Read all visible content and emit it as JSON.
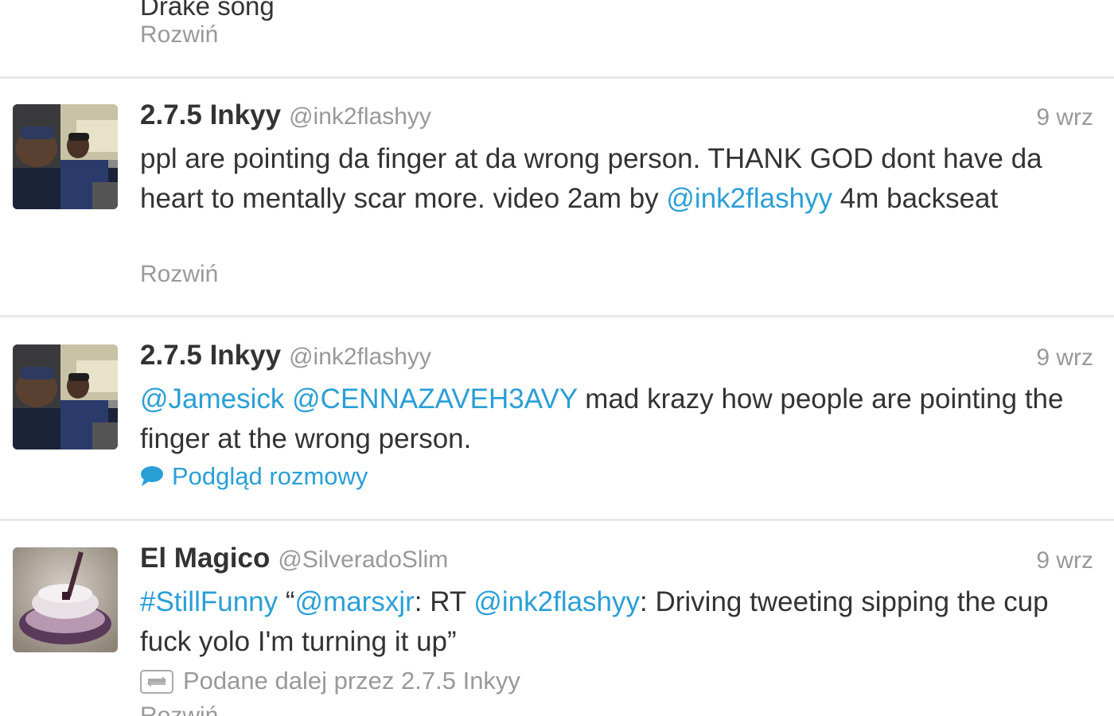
{
  "partial_tweet": {
    "text_fragment": "Drake song",
    "expand_label": "Rozwiń"
  },
  "tweets": [
    {
      "name": "2.7.5 Inkyy",
      "handle": "@ink2flashyy",
      "time": "9 wrz",
      "text": {
        "p1": "ppl are pointing da finger at da wrong person. THANK GOD dont have da heart to mentally scar more. video 2am by ",
        "mention1": "@ink2flashyy",
        "p2": " 4m backseat"
      },
      "expand_label": "Rozwiń"
    },
    {
      "name": "2.7.5 Inkyy",
      "handle": "@ink2flashyy",
      "time": "9 wrz",
      "text": {
        "mention1": "@Jamesick",
        "sep1": " ",
        "mention2": "@CENNAZAVEH3AVY",
        "p1": " mad krazy how people are pointing the finger at the wrong person."
      },
      "conversation_label": "Podgląd rozmowy"
    },
    {
      "name": "El Magico",
      "handle": "@SilveradoSlim",
      "time": "9 wrz",
      "text": {
        "hashtag": "#StillFunny",
        "p1": " “",
        "mention1": "@marsxjr",
        "p2": ": RT ",
        "mention2": "@ink2flashyy",
        "p3": ": Driving tweeting sipping the cup fuck yolo I'm turning it up”"
      },
      "retweeted_by": "Podane dalej przez 2.7.5 Inkyy",
      "expand_label": "Rozwiń"
    }
  ],
  "colors": {
    "link": "#2a9fd6",
    "text": "#333333",
    "muted": "#999999",
    "divider": "#e8e8e8"
  },
  "icons": {
    "conversation": "speech-bubble-icon",
    "retweet": "retweet-icon"
  }
}
